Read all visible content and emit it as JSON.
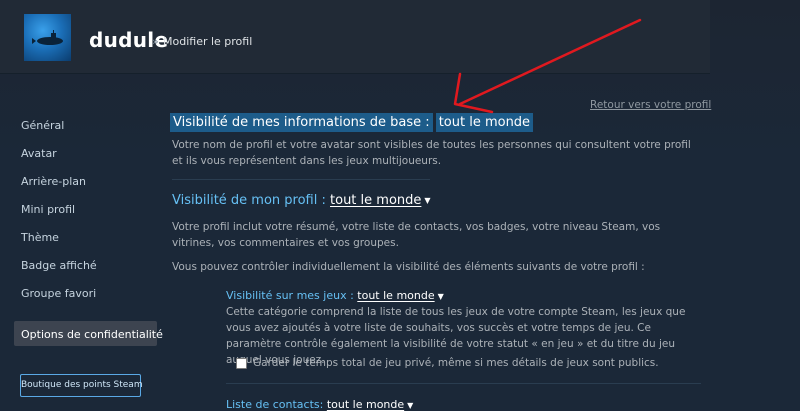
{
  "header": {
    "username": "dudule",
    "separator": "»",
    "subtitle": "Modifier le profil"
  },
  "sidebar": {
    "items": [
      {
        "label": "Général"
      },
      {
        "label": "Avatar"
      },
      {
        "label": "Arrière-plan"
      },
      {
        "label": "Mini profil"
      },
      {
        "label": "Thème"
      },
      {
        "label": "Badge affiché"
      },
      {
        "label": "Groupe favori"
      }
    ],
    "active_item": "Options de confidentialité",
    "points_button": "Boutique des points Steam"
  },
  "main": {
    "back_link": "Retour vers votre profil",
    "basic_info": {
      "label": "Visibilité de mes informations de base :",
      "value": "tout le monde",
      "description": "Votre nom de profil et votre avatar sont visibles de toutes les personnes qui consultent votre profil et ils vous représentent dans les jeux multijoueurs."
    },
    "profile": {
      "label": "Visibilité de mon profil :",
      "value": "tout le monde",
      "description": "Votre profil inclut votre résumé, votre liste de contacts, vos badges, votre niveau Steam, vos vitrines, vos commentaires et vos groupes.",
      "control_note": "Vous pouvez contrôler individuellement la visibilité des éléments suivants de votre profil :"
    },
    "games": {
      "label": "Visibilité sur mes jeux :",
      "value": "tout le monde",
      "description": "Cette catégorie comprend la liste de tous les jeux de votre compte Steam, les jeux que vous avez ajoutés à votre liste de souhaits, vos succès et votre temps de jeu. Ce paramètre contrôle également la visibilité de votre statut « en jeu » et du titre du jeu auquel vous jouez.",
      "checkbox_label": "Garder le temps total de jeu privé, même si mes détails de jeux sont publics.",
      "checkbox_checked": false
    },
    "friends": {
      "label": "Liste de contacts:",
      "value": "tout le monde"
    }
  },
  "icons": {
    "dropdown": "caret-down-icon",
    "annotation": "red-arrow-annotation"
  },
  "colors": {
    "background": "#1b2838",
    "accent_blue": "#66c0f4",
    "highlight": "#1d5c8a",
    "annotation_red": "#e0191f"
  }
}
